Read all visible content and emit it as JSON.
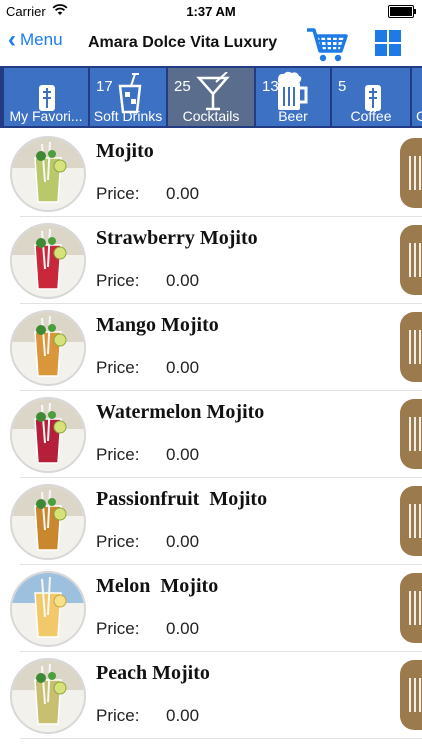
{
  "status": {
    "carrier": "Carrier",
    "time": "1:37 AM"
  },
  "nav": {
    "back_label": "Menu",
    "title": "Amara Dolce Vita Luxury",
    "accent": "#1a7cf6"
  },
  "tabs": [
    {
      "count": "",
      "label": "My Favori...",
      "icon": "bottle-icon"
    },
    {
      "count": "17",
      "label": "Soft Drinks",
      "icon": "glass-icon"
    },
    {
      "count": "25",
      "label": "Cocktails",
      "icon": "martini-icon",
      "selected": true
    },
    {
      "count": "13",
      "label": "Beer",
      "icon": "beer-mug-icon"
    },
    {
      "count": "5",
      "label": "Coffee",
      "icon": "bottle-icon"
    },
    {
      "count": "",
      "label": "C",
      "icon": ""
    }
  ],
  "items": [
    {
      "name": "Mojito",
      "price_label": "Price:",
      "price": "0.00",
      "drink_color": "#b8c86a"
    },
    {
      "name": "Strawberry Mojito",
      "price_label": "Price:",
      "price": "0.00",
      "drink_color": "#c8283a"
    },
    {
      "name": "Mango Mojito",
      "price_label": "Price:",
      "price": "0.00",
      "drink_color": "#d9963a"
    },
    {
      "name": "Watermelon Mojito",
      "price_label": "Price:",
      "price": "0.00",
      "drink_color": "#b51f3a"
    },
    {
      "name": "Passionfruit  Mojito",
      "price_label": "Price:",
      "price": "0.00",
      "drink_color": "#c9882e"
    },
    {
      "name": "Melon  Mojito",
      "price_label": "Price:",
      "price": "0.00",
      "drink_color": "#f2c96a"
    },
    {
      "name": "Peach Mojito",
      "price_label": "Price:",
      "price": "0.00",
      "drink_color": "#c8c070"
    }
  ]
}
